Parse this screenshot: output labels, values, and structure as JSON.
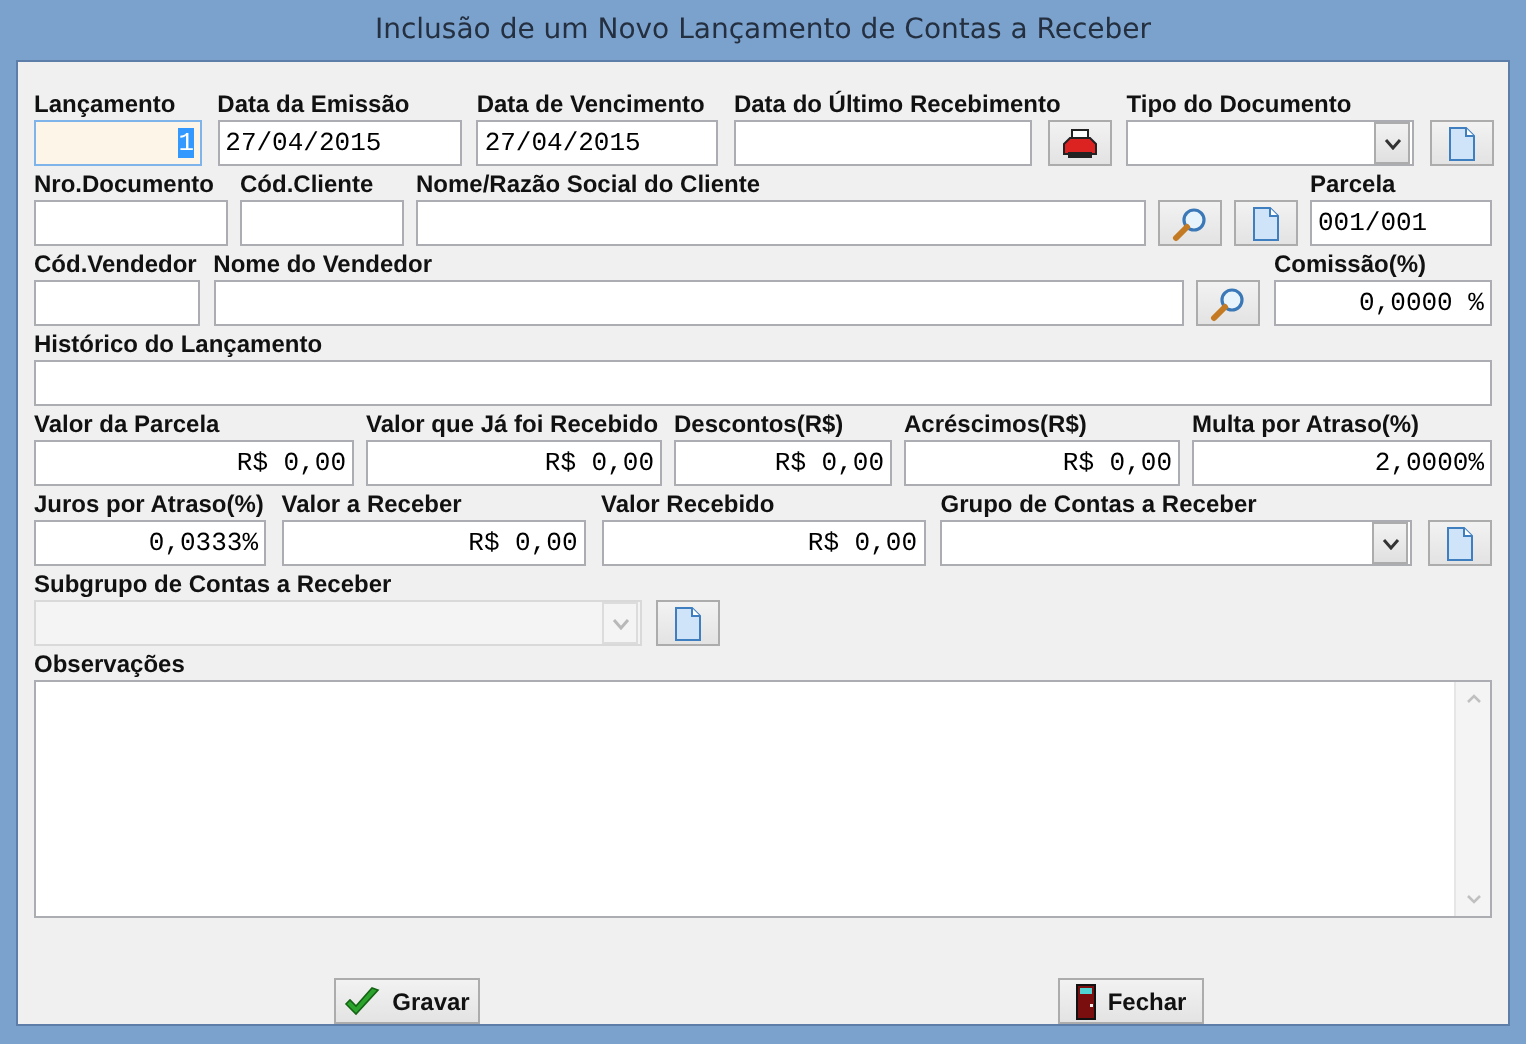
{
  "window": {
    "title": "Inclusão de um Novo Lançamento de Contas a Receber"
  },
  "rows": [
    [
      {
        "kind": "number",
        "label": "Lançamento",
        "value": "1",
        "focused": true
      },
      {
        "kind": "text",
        "label": "Data da Emissão",
        "value": "27/04/2015",
        "focused": false
      },
      {
        "kind": "text",
        "label": "Data de Vencimento",
        "value": "27/04/2015",
        "focused": false
      },
      {
        "kind": "text",
        "label": "Data do Último Recebimento",
        "focused": false
      },
      {
        "kind": "print-button"
      },
      {
        "kind": "select",
        "label": "Tipo do Documento",
        "disabled": false
      },
      {
        "kind": "new-button"
      }
    ],
    [
      {
        "kind": "text",
        "label": "Nro.Documento",
        "focused": false
      },
      {
        "kind": "text",
        "label": "Cód.Cliente",
        "focused": false
      },
      {
        "kind": "text",
        "label": "Nome/Razão Social do Cliente",
        "focused": false
      },
      {
        "kind": "search-button"
      },
      {
        "kind": "new-button"
      },
      {
        "kind": "text",
        "label": "Parcela",
        "value": "001/001",
        "focused": false
      }
    ],
    [
      {
        "kind": "text",
        "label": "Cód.Vendedor",
        "focused": false
      },
      {
        "kind": "text",
        "label": "Nome do Vendedor",
        "focused": false
      },
      {
        "kind": "search-button"
      },
      {
        "kind": "number",
        "label": "Comissão(%)",
        "value": "0,0000 %",
        "focused": false
      }
    ],
    [
      {
        "kind": "text",
        "label": "Histórico do Lançamento",
        "focused": false
      }
    ],
    [
      {
        "kind": "number",
        "label": "Valor da Parcela",
        "value": "R$ 0,00",
        "focused": false
      },
      {
        "kind": "number",
        "label": "Valor que Já foi Recebido",
        "value": "R$ 0,00",
        "focused": false
      },
      {
        "kind": "number",
        "label": "Descontos(R$)",
        "value": "R$ 0,00",
        "focused": false
      },
      {
        "kind": "number",
        "label": "Acréscimos(R$)",
        "value": "R$ 0,00",
        "focused": false
      },
      {
        "kind": "number",
        "label": "Multa por Atraso(%)",
        "value": "2,0000%",
        "focused": false
      }
    ],
    [
      {
        "kind": "number",
        "label": "Juros por Atraso(%)",
        "value": "0,0333%",
        "focused": false
      },
      {
        "kind": "number",
        "label": "Valor a Receber",
        "value": "R$ 0,00",
        "focused": false
      },
      {
        "kind": "number",
        "label": "Valor Recebido",
        "value": "R$ 0,00",
        "focused": false
      },
      {
        "kind": "select",
        "label": "Grupo de Contas a Receber",
        "disabled": false
      },
      {
        "kind": "new-button"
      }
    ],
    [
      {
        "kind": "select",
        "label": "Subgrupo de Contas a Receber",
        "disabled": true
      },
      {
        "kind": "new-button"
      }
    ],
    [
      {
        "kind": "textarea",
        "label": "Observações"
      }
    ]
  ],
  "buttons": [
    {
      "kind": "save",
      "label": "Gravar"
    },
    {
      "kind": "close",
      "label": "Fechar"
    }
  ]
}
